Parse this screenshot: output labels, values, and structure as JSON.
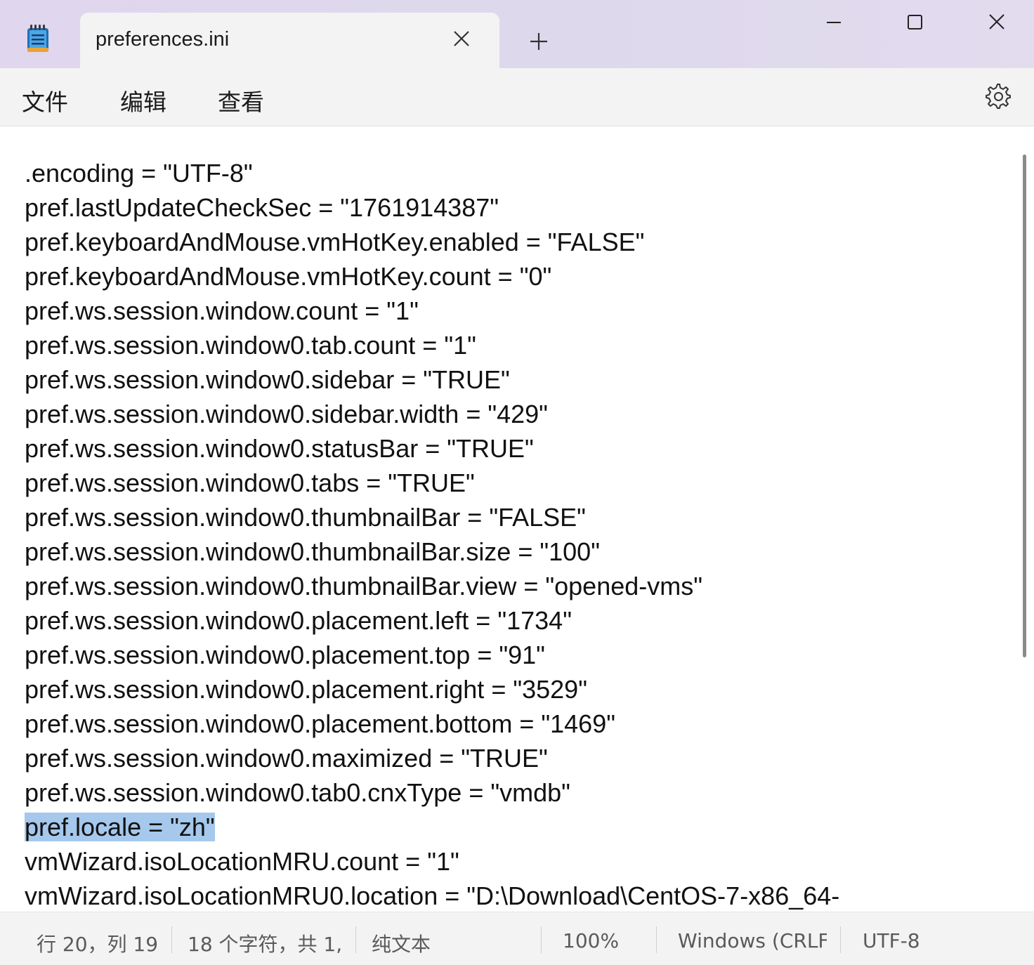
{
  "tab": {
    "title": "preferences.ini"
  },
  "icons": {
    "app": "notepad-icon",
    "tab_close": "close-icon",
    "new_tab": "plus-icon",
    "minimize": "minimize-icon",
    "maximize": "maximize-icon",
    "close": "close-icon",
    "settings": "gear-icon"
  },
  "menu": {
    "file": "文件",
    "edit": "编辑",
    "view": "查看"
  },
  "editor": {
    "lines": [
      ".encoding = \"UTF-8\"",
      "pref.lastUpdateCheckSec = \"1761914387\"",
      "pref.keyboardAndMouse.vmHotKey.enabled = \"FALSE\"",
      "pref.keyboardAndMouse.vmHotKey.count = \"0\"",
      "pref.ws.session.window.count = \"1\"",
      "pref.ws.session.window0.tab.count = \"1\"",
      "pref.ws.session.window0.sidebar = \"TRUE\"",
      "pref.ws.session.window0.sidebar.width = \"429\"",
      "pref.ws.session.window0.statusBar = \"TRUE\"",
      "pref.ws.session.window0.tabs = \"TRUE\"",
      "pref.ws.session.window0.thumbnailBar = \"FALSE\"",
      "pref.ws.session.window0.thumbnailBar.size = \"100\"",
      "pref.ws.session.window0.thumbnailBar.view = \"opened-vms\"",
      "pref.ws.session.window0.placement.left = \"1734\"",
      "pref.ws.session.window0.placement.top = \"91\"",
      "pref.ws.session.window0.placement.right = \"3529\"",
      "pref.ws.session.window0.placement.bottom = \"1469\"",
      "pref.ws.session.window0.maximized = \"TRUE\"",
      "pref.ws.session.window0.tab0.cnxType = \"vmdb\"",
      "pref.locale = \"zh\"",
      "vmWizard.isoLocationMRU.count = \"1\"",
      "vmWizard.isoLocationMRU0.location = \"D:\\Download\\CentOS-7-x86_64-"
    ],
    "selected_line_index": 19,
    "selection_color": "#a5c8ec"
  },
  "status": {
    "position": "行 20，列 19",
    "char_count": "18 个字符，共 1,",
    "format": "纯文本",
    "zoom": "100%",
    "line_ending": "Windows (CRLF)",
    "encoding": "UTF-8"
  }
}
